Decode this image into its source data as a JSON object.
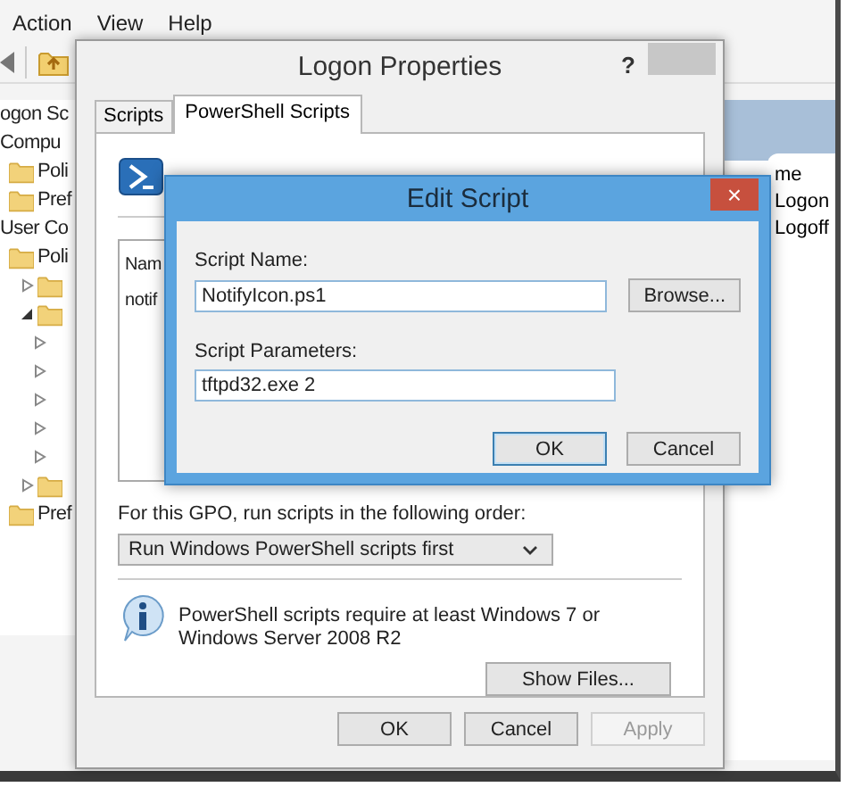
{
  "background_window": {
    "menu": [
      {
        "label": "Action"
      },
      {
        "label": "View"
      },
      {
        "label": "Help"
      }
    ],
    "tree": [
      {
        "label": "ogon Sc"
      },
      {
        "label": "Compu",
        "children": [
          {
            "label": "Poli",
            "kind": "folder"
          },
          {
            "label": "Pref",
            "kind": "folder"
          }
        ]
      },
      {
        "label": "User Co",
        "children": [
          {
            "label": "Poli",
            "kind": "folder",
            "children": [
              {
                "kind": "folder",
                "expanded": false
              },
              {
                "kind": "folder",
                "expanded": true,
                "children": [
                  {
                    "expanded": false
                  },
                  {
                    "expanded": false
                  },
                  {
                    "expanded": false
                  },
                  {
                    "expanded": false
                  },
                  {
                    "expanded": false
                  }
                ]
              },
              {
                "kind": "folder",
                "expanded": false
              }
            ]
          },
          {
            "label": "Pref",
            "kind": "folder"
          }
        ]
      }
    ],
    "right_pane": {
      "column": "me",
      "rows": [
        "Logon",
        "Logoff"
      ]
    }
  },
  "logon_properties": {
    "title": "Logon Properties",
    "help": "?",
    "tabs": [
      {
        "label": "Scripts",
        "selected": false
      },
      {
        "label": "PowerShell Scripts",
        "selected": true
      }
    ],
    "list": {
      "column": "Nam",
      "rows": [
        "notif"
      ]
    },
    "order_label": "For this GPO, run scripts in the following order:",
    "order_value": "Run Windows PowerShell scripts first",
    "info": "PowerShell scripts require at least Windows 7 or Windows Server 2008 R2",
    "show_files": "Show Files...",
    "buttons": [
      {
        "label": "OK",
        "disabled": false
      },
      {
        "label": "Cancel",
        "disabled": false
      },
      {
        "label": "Apply",
        "disabled": true
      }
    ]
  },
  "edit_script": {
    "title": "Edit Script",
    "close": "×",
    "name_label": "Script Name:",
    "name_value": "NotifyIcon.ps1",
    "browse": "Browse...",
    "params_label": "Script Parameters:",
    "params_value": "tftpd32.exe 2",
    "buttons": [
      {
        "label": "OK",
        "default": true
      },
      {
        "label": "Cancel",
        "default": false
      }
    ]
  }
}
